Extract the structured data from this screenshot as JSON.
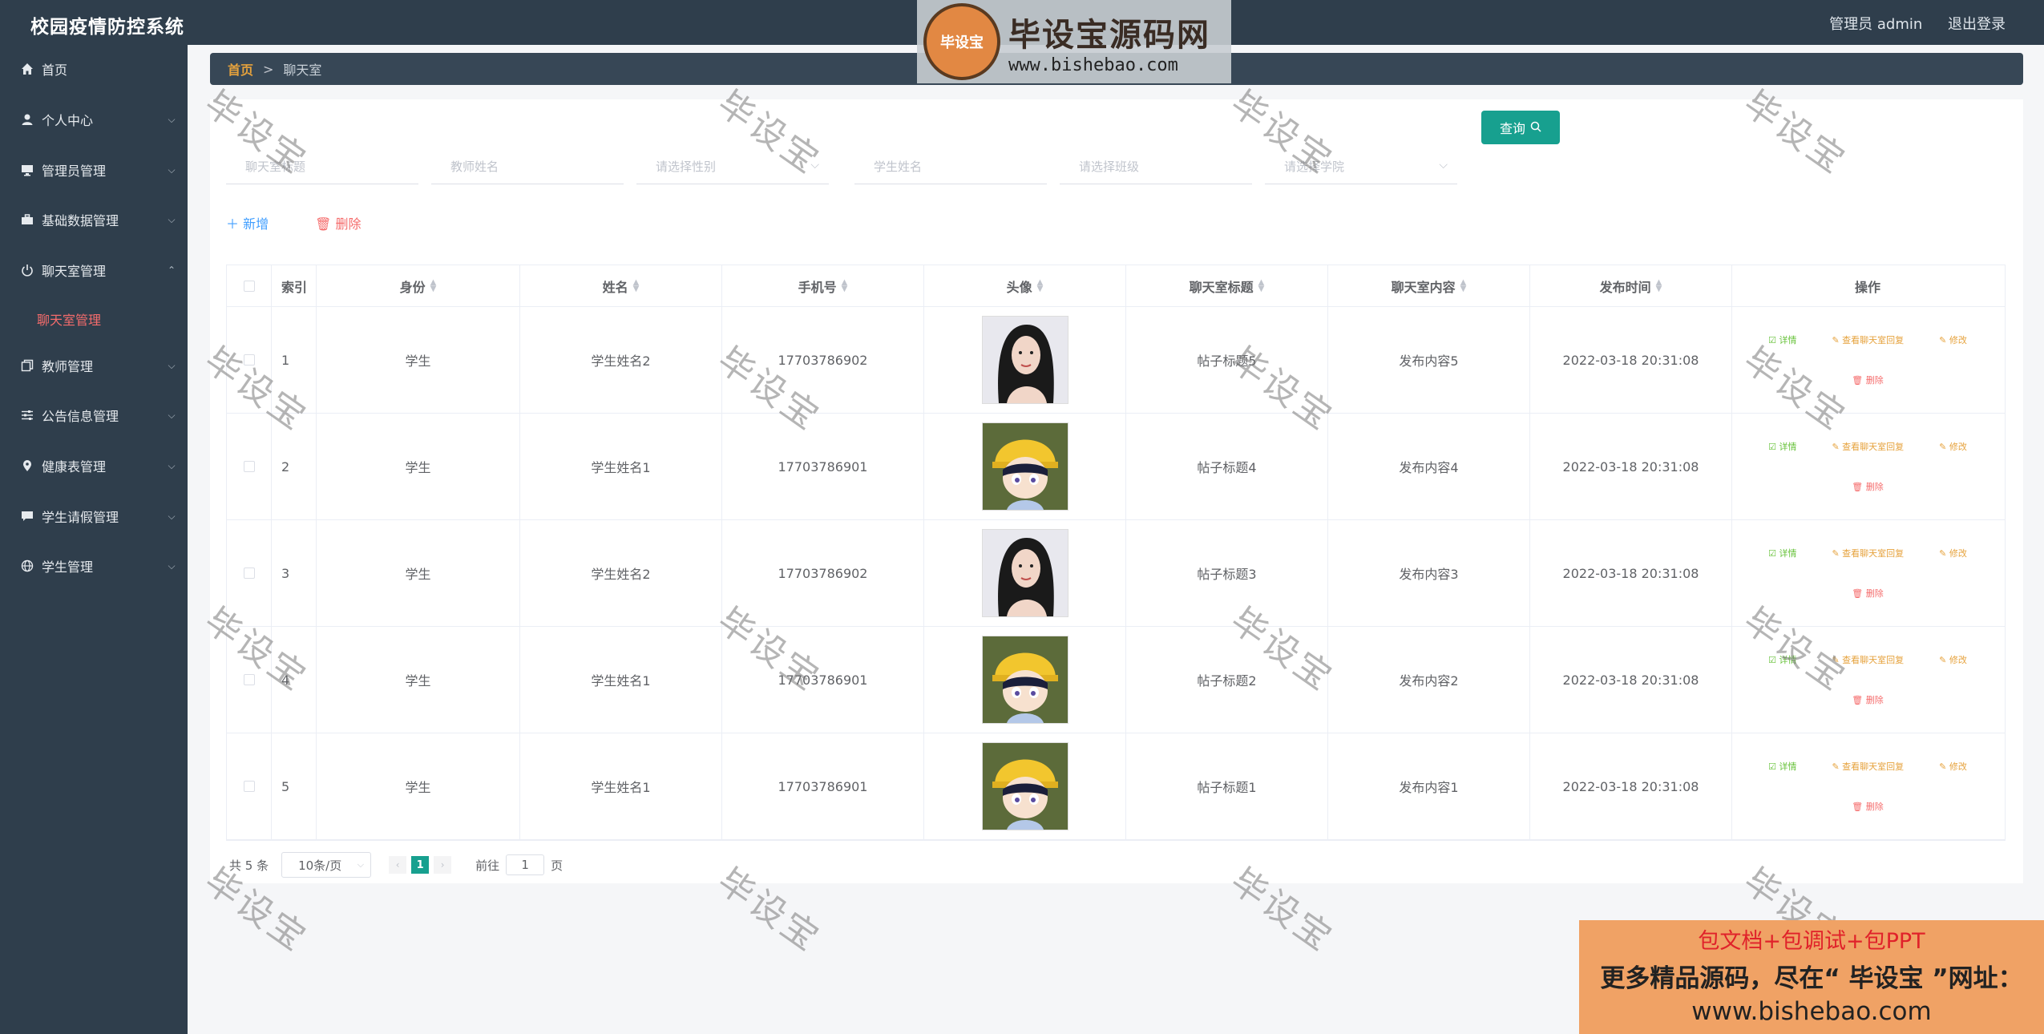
{
  "app": {
    "title": "校园疫情防控系统",
    "user_label": "管理员 admin",
    "logout_label": "退出登录"
  },
  "sidebar": {
    "items": [
      {
        "label": "首页",
        "icon": "home-icon",
        "has_arrow": false
      },
      {
        "label": "个人中心",
        "icon": "user-icon",
        "has_arrow": true
      },
      {
        "label": "管理员管理",
        "icon": "monitor-icon",
        "has_arrow": true
      },
      {
        "label": "基础数据管理",
        "icon": "briefcase-icon",
        "has_arrow": true
      },
      {
        "label": "聊天室管理",
        "icon": "power-icon",
        "has_arrow": true,
        "expanded": true
      },
      {
        "label": "教师管理",
        "icon": "copy-icon",
        "has_arrow": true
      },
      {
        "label": "公告信息管理",
        "icon": "sliders-icon",
        "has_arrow": true
      },
      {
        "label": "健康表管理",
        "icon": "location-icon",
        "has_arrow": true
      },
      {
        "label": "学生请假管理",
        "icon": "chat-icon",
        "has_arrow": true
      },
      {
        "label": "学生管理",
        "icon": "globe-icon",
        "has_arrow": true
      }
    ],
    "sub_item": "聊天室管理"
  },
  "breadcrumb": {
    "home": "首页",
    "sep": ">",
    "current": "聊天室"
  },
  "filters": {
    "chat_title": "聊天室标题",
    "teacher_name": "教师姓名",
    "gender": "请选择性别",
    "student_name": "学生姓名",
    "class": "请选择班级",
    "college": "请选择学院",
    "search_label": "查询"
  },
  "actions": {
    "add": "新增",
    "delete": "删除"
  },
  "table": {
    "headers": [
      "索引",
      "身份",
      "姓名",
      "手机号",
      "头像",
      "聊天室标题",
      "聊天室内容",
      "发布时间",
      "操作"
    ],
    "rows": [
      {
        "index": "1",
        "identity": "学生",
        "name": "学生姓名2",
        "phone": "17703786902",
        "avatar": "woman",
        "title": "帖子标题5",
        "content": "发布内容5",
        "time": "2022-03-18 20:31:08"
      },
      {
        "index": "2",
        "identity": "学生",
        "name": "学生姓名1",
        "phone": "17703786901",
        "avatar": "boy",
        "title": "帖子标题4",
        "content": "发布内容4",
        "time": "2022-03-18 20:31:08"
      },
      {
        "index": "3",
        "identity": "学生",
        "name": "学生姓名2",
        "phone": "17703786902",
        "avatar": "woman",
        "title": "帖子标题3",
        "content": "发布内容3",
        "time": "2022-03-18 20:31:08"
      },
      {
        "index": "4",
        "identity": "学生",
        "name": "学生姓名1",
        "phone": "17703786901",
        "avatar": "boy",
        "title": "帖子标题2",
        "content": "发布内容2",
        "time": "2022-03-18 20:31:08"
      },
      {
        "index": "5",
        "identity": "学生",
        "name": "学生姓名1",
        "phone": "17703786901",
        "avatar": "boy",
        "title": "帖子标题1",
        "content": "发布内容1",
        "time": "2022-03-18 20:31:08"
      }
    ],
    "ops": {
      "detail": "详情",
      "view_reply": "查看聊天室回复",
      "edit": "修改",
      "delete": "删除"
    }
  },
  "pager": {
    "total": "共 5 条",
    "page_size": "10条/页",
    "current_page": "1",
    "goto_label": "前往",
    "goto_value": "1",
    "page_unit": "页"
  },
  "watermark": {
    "text": "毕设宝"
  },
  "logo": {
    "badge": "毕设宝",
    "main": "毕设宝源码网",
    "url": "www.bishebao.com"
  },
  "promo": {
    "line1": "包文档+包调试+包PPT",
    "line2": "更多精品源码，尽在“ 毕设宝 ”网址：",
    "line3": "www.bishebao.com"
  },
  "colors": {
    "sidebar_bg": "#2f3e4c",
    "accent": "#17a08f",
    "danger": "#f56c6c",
    "warning": "#e6a23c",
    "success": "#67c23a"
  }
}
